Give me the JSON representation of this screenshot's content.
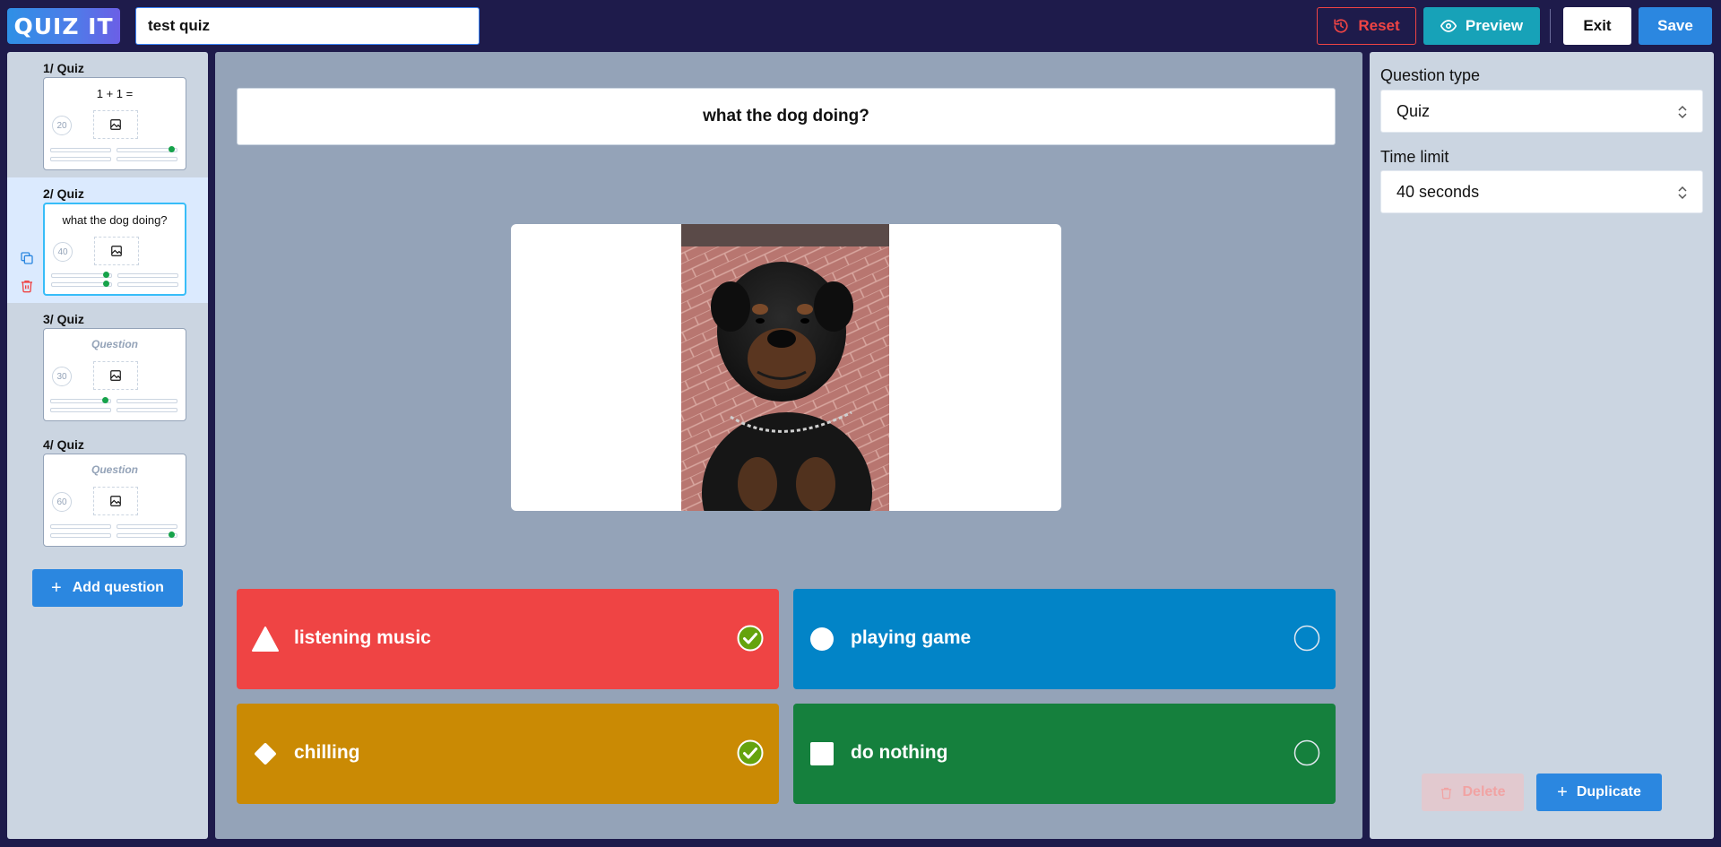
{
  "header": {
    "logo": "QUIZ IT",
    "title_value": "test quiz",
    "reset_label": "Reset",
    "preview_label": "Preview",
    "exit_label": "Exit",
    "save_label": "Save"
  },
  "sidebar": {
    "slides": [
      {
        "label": "1/ Quiz",
        "question": "1 + 1 =",
        "time": "20",
        "correct": [
          2
        ]
      },
      {
        "label": "2/ Quiz",
        "question": "what the dog doing?",
        "time": "40",
        "correct": [
          1,
          3
        ]
      },
      {
        "label": "3/ Quiz",
        "question": "Question",
        "time": "30",
        "correct": [
          1
        ]
      },
      {
        "label": "4/ Quiz",
        "question": "Question",
        "time": "60",
        "correct": [
          4
        ]
      }
    ],
    "add_question_label": "Add question"
  },
  "editor": {
    "question": "what the dog doing?",
    "answers": [
      {
        "text": "listening music",
        "shape": "triangle",
        "color": "#ef4444",
        "correct": true
      },
      {
        "text": "playing game",
        "shape": "circle",
        "color": "#0284c7",
        "correct": false
      },
      {
        "text": "chilling",
        "shape": "diamond",
        "color": "#ca8a04",
        "correct": true
      },
      {
        "text": "do nothing",
        "shape": "square",
        "color": "#15803d",
        "correct": false
      }
    ]
  },
  "settings": {
    "question_type_label": "Question type",
    "question_type_value": "Quiz",
    "time_limit_label": "Time limit",
    "time_limit_value": "40 seconds",
    "delete_label": "Delete",
    "duplicate_label": "Duplicate"
  },
  "colors": {
    "header_bg": "#1e1b4b",
    "primary": "#2b87e0",
    "preview": "#17a2b8",
    "danger": "#ef4444",
    "correct_check": "#65a30d"
  }
}
